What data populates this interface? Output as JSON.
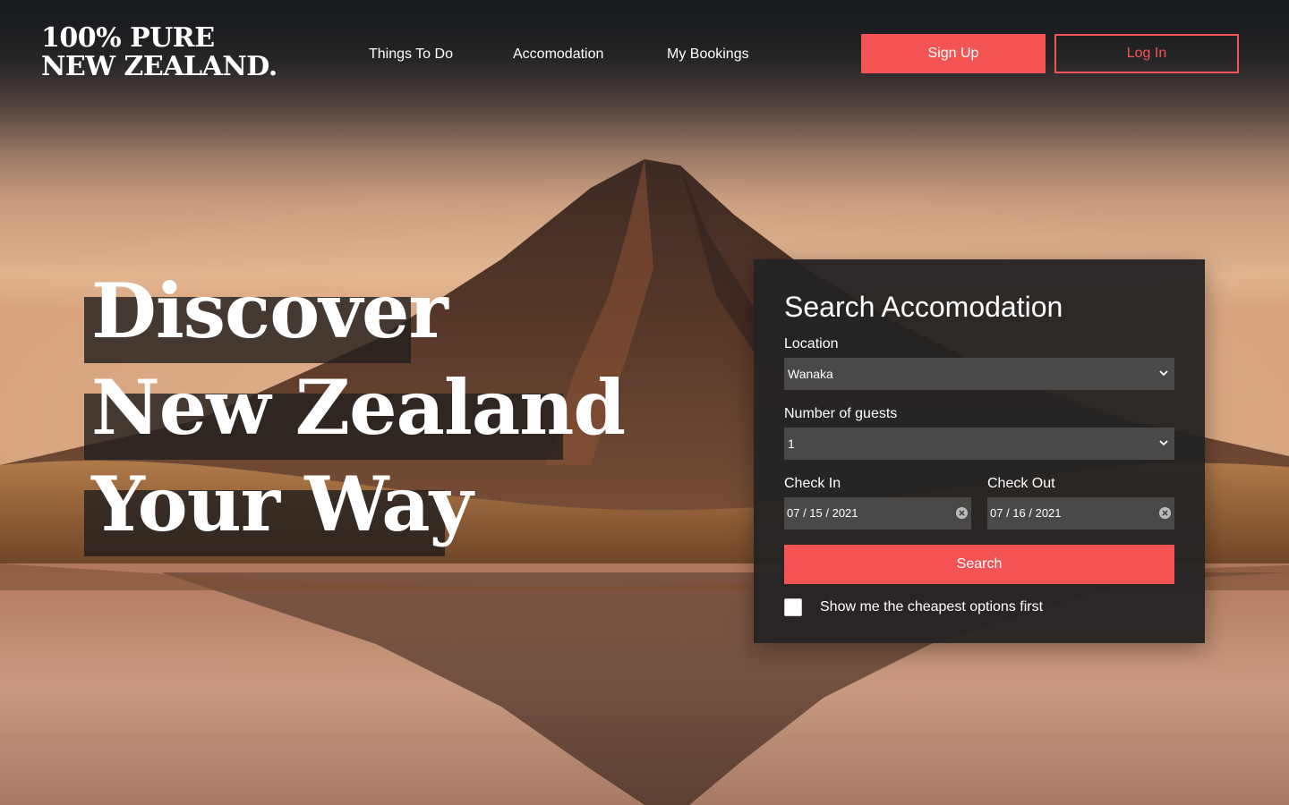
{
  "brand": {
    "logo_line1": "100% PURE",
    "logo_line2": "NEW ZEALAND."
  },
  "nav": {
    "items": [
      {
        "label": "Things To Do"
      },
      {
        "label": "Accomodation"
      },
      {
        "label": "My Bookings"
      }
    ],
    "signup_label": "Sign Up",
    "login_label": "Log In"
  },
  "hero": {
    "headline_lines": [
      "Discover",
      "New Zealand",
      "Your Way"
    ]
  },
  "search": {
    "title": "Search Accomodation",
    "location_label": "Location",
    "location_value": "Wanaka",
    "guests_label": "Number of guests",
    "guests_value": "1",
    "checkin_label": "Check In",
    "checkin_value": "07 / 15 / 2021",
    "checkout_label": "Check Out",
    "checkout_value": "07 / 16 / 2021",
    "search_label": "Search",
    "cheapest_label": "Show me the cheapest options first",
    "cheapest_checked": false
  },
  "icons": {
    "select_chevron": "chevron-down-icon",
    "date_clear": "clear-circle-icon"
  },
  "colors": {
    "accent": "#f45454",
    "panel": "#242323",
    "field": "#4a4948",
    "band": "#23201f"
  }
}
